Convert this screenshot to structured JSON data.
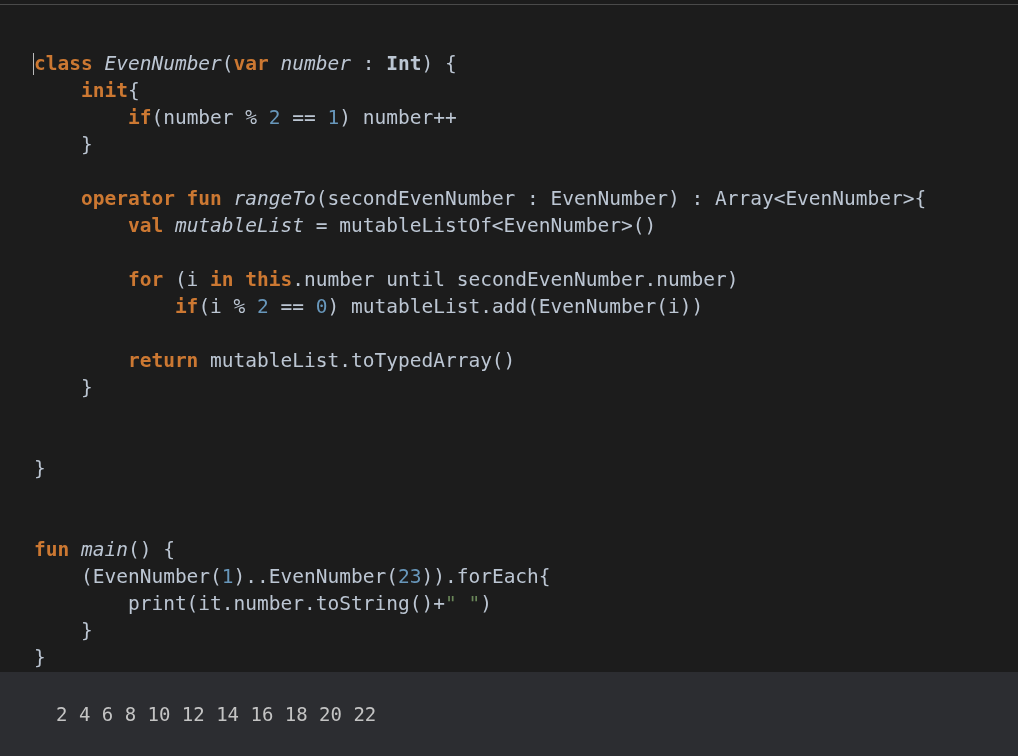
{
  "editor": {
    "lines": [
      {
        "kind": "code",
        "tokens": [
          {
            "kind": "keyword",
            "text": "class "
          },
          {
            "kind": "italic",
            "text": "EvenNumber"
          },
          {
            "kind": "plain",
            "text": "("
          },
          {
            "kind": "keyword",
            "text": "var "
          },
          {
            "kind": "italic",
            "text": "number"
          },
          {
            "kind": "plain",
            "text": " : "
          },
          {
            "kind": "bold",
            "text": "Int"
          },
          {
            "kind": "plain",
            "text": ") {"
          }
        ]
      },
      {
        "kind": "code",
        "tokens": [
          {
            "kind": "keyword",
            "text": "    init"
          },
          {
            "kind": "plain",
            "text": "{"
          }
        ]
      },
      {
        "kind": "code",
        "tokens": [
          {
            "kind": "keyword",
            "text": "        if"
          },
          {
            "kind": "plain",
            "text": "(number % "
          },
          {
            "kind": "number",
            "text": "2"
          },
          {
            "kind": "plain",
            "text": " == "
          },
          {
            "kind": "number",
            "text": "1"
          },
          {
            "kind": "plain",
            "text": ") number++"
          }
        ]
      },
      {
        "kind": "code",
        "tokens": [
          {
            "kind": "plain",
            "text": "    }"
          }
        ]
      },
      {
        "kind": "blank"
      },
      {
        "kind": "code",
        "tokens": [
          {
            "kind": "keyword",
            "text": "    operator fun "
          },
          {
            "kind": "italic",
            "text": "rangeTo"
          },
          {
            "kind": "plain",
            "text": "(secondEvenNumber : EvenNumber) : Array<EvenNumber>{"
          }
        ]
      },
      {
        "kind": "code",
        "tokens": [
          {
            "kind": "keyword",
            "text": "        val "
          },
          {
            "kind": "italic",
            "text": "mutableList"
          },
          {
            "kind": "plain",
            "text": " = mutableListOf<EvenNumber>()"
          }
        ]
      },
      {
        "kind": "blank"
      },
      {
        "kind": "code",
        "tokens": [
          {
            "kind": "keyword",
            "text": "        for"
          },
          {
            "kind": "plain",
            "text": " (i "
          },
          {
            "kind": "keyword",
            "text": "in this"
          },
          {
            "kind": "plain",
            "text": ".number until secondEvenNumber.number)"
          }
        ]
      },
      {
        "kind": "code",
        "tokens": [
          {
            "kind": "keyword",
            "text": "            if"
          },
          {
            "kind": "plain",
            "text": "(i % "
          },
          {
            "kind": "number",
            "text": "2"
          },
          {
            "kind": "plain",
            "text": " == "
          },
          {
            "kind": "number",
            "text": "0"
          },
          {
            "kind": "plain",
            "text": ") mutableList.add(EvenNumber(i))"
          }
        ]
      },
      {
        "kind": "blank"
      },
      {
        "kind": "code",
        "tokens": [
          {
            "kind": "keyword",
            "text": "        return"
          },
          {
            "kind": "plain",
            "text": " mutableList.toTypedArray()"
          }
        ]
      },
      {
        "kind": "code",
        "tokens": [
          {
            "kind": "plain",
            "text": "    }"
          }
        ]
      },
      {
        "kind": "blank"
      },
      {
        "kind": "blank"
      },
      {
        "kind": "code",
        "tokens": [
          {
            "kind": "plain",
            "text": "}"
          }
        ]
      },
      {
        "kind": "blank"
      },
      {
        "kind": "blank"
      },
      {
        "kind": "code",
        "tokens": [
          {
            "kind": "keyword",
            "text": "fun "
          },
          {
            "kind": "italic",
            "text": "main"
          },
          {
            "kind": "plain",
            "text": "() {"
          }
        ]
      },
      {
        "kind": "code",
        "tokens": [
          {
            "kind": "plain",
            "text": "    (EvenNumber("
          },
          {
            "kind": "number",
            "text": "1"
          },
          {
            "kind": "plain",
            "text": ")..EvenNumber("
          },
          {
            "kind": "number",
            "text": "23"
          },
          {
            "kind": "plain",
            "text": ")).forEach{"
          }
        ]
      },
      {
        "kind": "code",
        "tokens": [
          {
            "kind": "plain",
            "text": "        print(it.number.toString()+"
          },
          {
            "kind": "string",
            "text": "\" \""
          },
          {
            "kind": "plain",
            "text": ")"
          }
        ]
      },
      {
        "kind": "code",
        "tokens": [
          {
            "kind": "plain",
            "text": "    }"
          }
        ]
      },
      {
        "kind": "code",
        "tokens": [
          {
            "kind": "plain",
            "text": "}"
          }
        ]
      }
    ]
  },
  "output": {
    "text": "2 4 6 8 10 12 14 16 18 20 22"
  }
}
